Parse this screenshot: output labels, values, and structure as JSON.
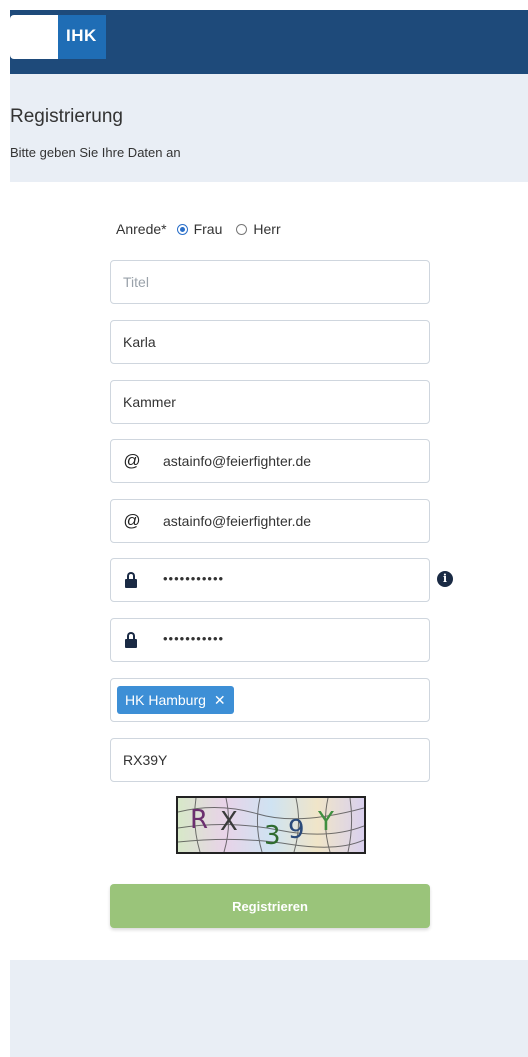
{
  "header": {
    "logo_text": "IHK"
  },
  "page": {
    "title": "Registrierung",
    "subtitle": "Bitte geben Sie Ihre Daten an"
  },
  "form": {
    "anrede_label": "Anrede*",
    "anrede_options": [
      {
        "label": "Frau",
        "selected": true
      },
      {
        "label": "Herr",
        "selected": false
      }
    ],
    "titel": {
      "placeholder": "Titel",
      "value": ""
    },
    "vorname": {
      "value": "Karla"
    },
    "nachname": {
      "value": "Kammer"
    },
    "email": {
      "icon": "at-icon",
      "value": "astainfo@feierfighter.de"
    },
    "email_confirm": {
      "icon": "at-icon",
      "value": "astainfo@feierfighter.de"
    },
    "password": {
      "icon": "lock-icon",
      "masked": "•••••••••••"
    },
    "password_confirm": {
      "icon": "lock-icon",
      "masked": "•••••••••••"
    },
    "chamber_tag": "HK Hamburg",
    "captcha_input": {
      "value": "RX39Y"
    },
    "captcha_text": "RX39Y",
    "submit_label": "Registrieren"
  },
  "colors": {
    "header_bg": "#1e4a7a",
    "tag_bg": "#3d8fd6",
    "submit_bg": "#9ac47a",
    "radio_accent": "#2a6fc9"
  }
}
